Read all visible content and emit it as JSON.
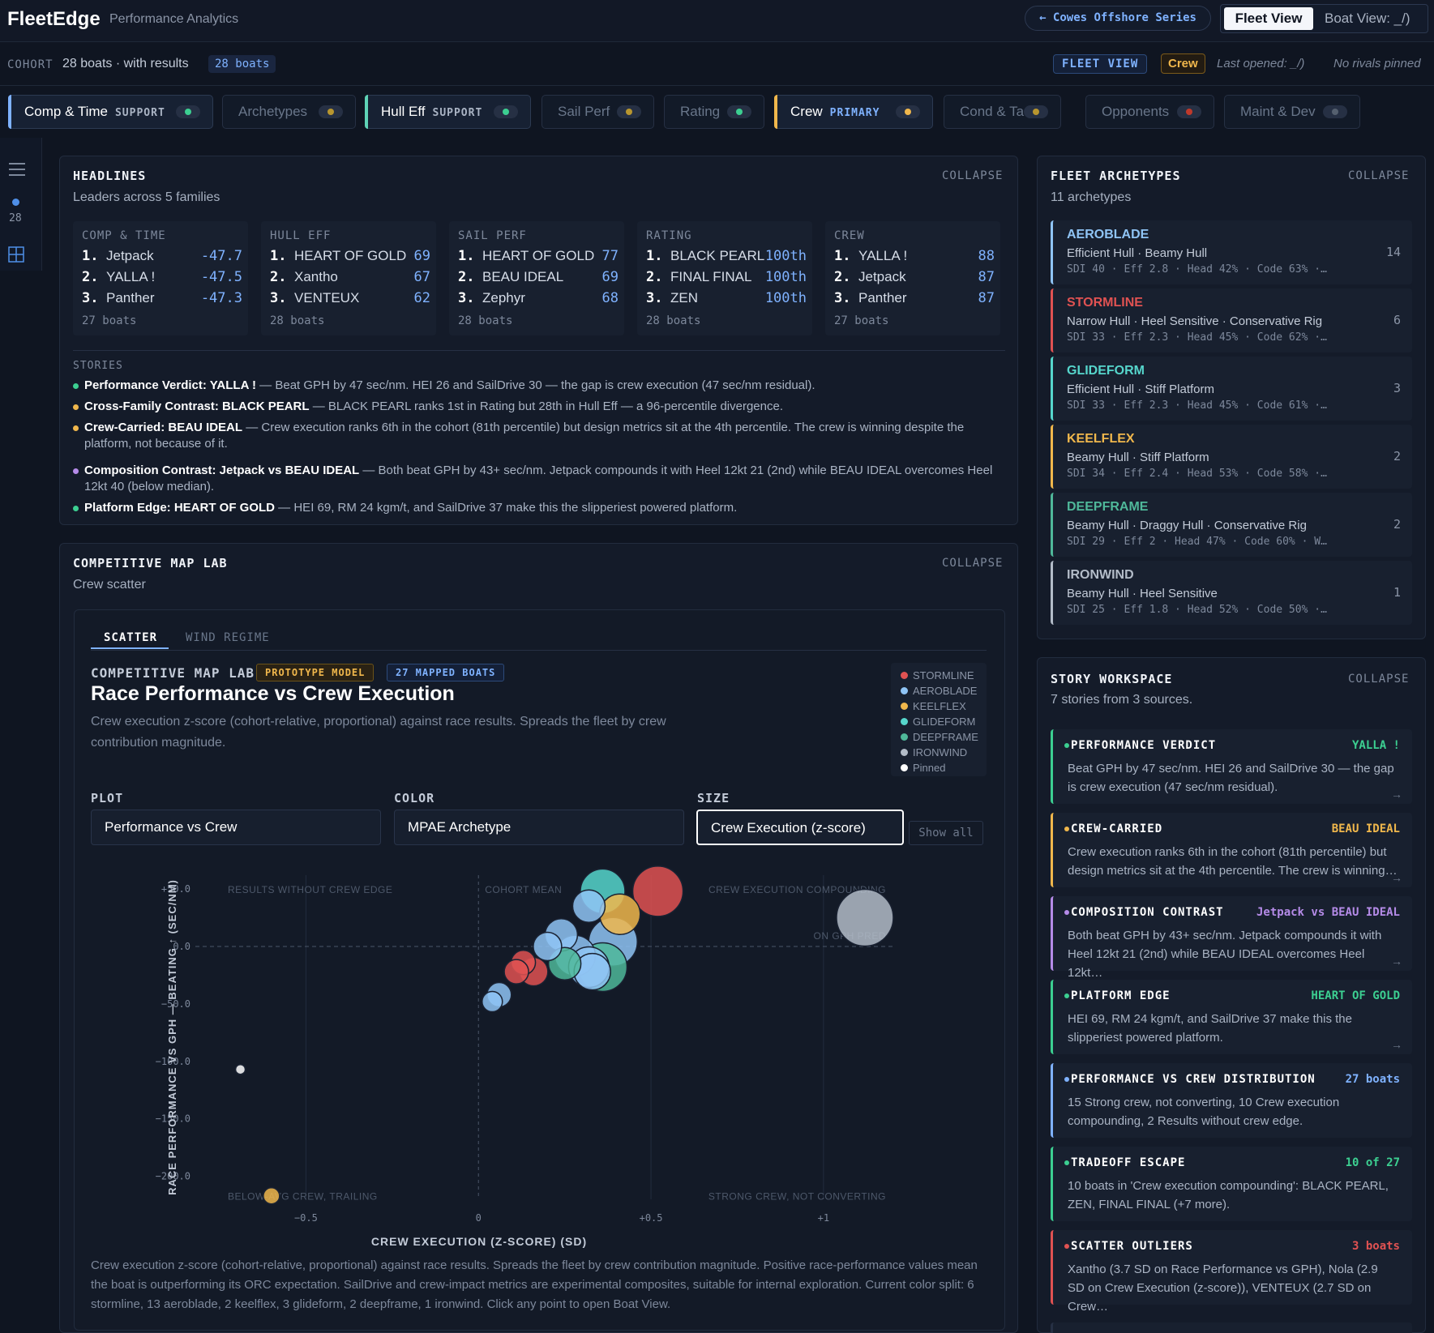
{
  "header": {
    "logo": "FleetEdge",
    "subtitle": "Performance Analytics",
    "series_button": "← Cowes Offshore Series",
    "fleet_view": "Fleet View",
    "boat_view": "Boat View: _/)"
  },
  "cohort": {
    "label": "COHORT",
    "text": "28 boats · with results",
    "badge": "28 boats",
    "fleet_view_badge": "FLEET VIEW",
    "crew_badge": "Crew",
    "last_opened": "Last opened: _/)",
    "no_rivals": "No rivals pinned"
  },
  "tabs": [
    {
      "label": "Comp & Time",
      "role": "SUPPORT",
      "active": true,
      "accent": "#7fb2ff",
      "dot": "#3ccf91"
    },
    {
      "label": "Archetypes",
      "role": "",
      "active": false,
      "dot": "#b8962f"
    },
    {
      "label": "Hull Eff",
      "role": "SUPPORT",
      "active": true,
      "accent": "#5fd3b6",
      "dot": "#3ccf91"
    },
    {
      "label": "Sail Perf",
      "role": "",
      "active": false,
      "dot": "#b8962f"
    },
    {
      "label": "Rating",
      "role": "",
      "active": false,
      "dot": "#3ccf91"
    },
    {
      "label": "Crew",
      "role": "PRIMARY",
      "active": true,
      "accent": "#f0b74c",
      "dot": "#f0b74c"
    },
    {
      "label": "Cond & Tac",
      "role": "",
      "active": false,
      "dot": "#b8962f"
    },
    {
      "label": "Opponents",
      "role": "",
      "active": false,
      "dot": "#c0392b"
    },
    {
      "label": "Maint & Dev",
      "role": "",
      "active": false,
      "dot": "#55606f"
    }
  ],
  "rail": {
    "count": "28"
  },
  "headlines": {
    "title": "HEADLINES",
    "subtitle": "Leaders across 5 families",
    "collapse": "COLLAPSE",
    "columns": [
      {
        "cat": "COMP & TIME",
        "rows": [
          [
            "1.",
            "Jetpack",
            "-47.7"
          ],
          [
            "2.",
            "YALLA !",
            "-47.5"
          ],
          [
            "3.",
            "Panther",
            "-47.3"
          ]
        ],
        "count": "27 boats"
      },
      {
        "cat": "HULL EFF",
        "rows": [
          [
            "1.",
            "HEART OF GOLD",
            "69"
          ],
          [
            "2.",
            "Xantho",
            "67"
          ],
          [
            "3.",
            "VENTEUX",
            "62"
          ]
        ],
        "count": "28 boats"
      },
      {
        "cat": "SAIL PERF",
        "rows": [
          [
            "1.",
            "HEART OF GOLD",
            "77"
          ],
          [
            "2.",
            "BEAU IDEAL",
            "69"
          ],
          [
            "3.",
            "Zephyr",
            "68"
          ]
        ],
        "count": "28 boats"
      },
      {
        "cat": "RATING",
        "rows": [
          [
            "1.",
            "BLACK PEARL",
            "100th"
          ],
          [
            "2.",
            "FINAL FINAL",
            "100th"
          ],
          [
            "3.",
            "ZEN",
            "100th"
          ]
        ],
        "count": "28 boats"
      },
      {
        "cat": "CREW",
        "rows": [
          [
            "1.",
            "YALLA !",
            "88"
          ],
          [
            "2.",
            "Jetpack",
            "87"
          ],
          [
            "3.",
            "Panther",
            "87"
          ]
        ],
        "count": "27 boats"
      }
    ],
    "stories_label": "STORIES",
    "stories": [
      {
        "color": "#3ccf91",
        "head": "Performance Verdict: YALLA !",
        "text": " — Beat GPH by 47 sec/nm. HEI 26 and SailDrive 30 — the gap is crew execution (47 sec/nm residual)."
      },
      {
        "color": "#f0b74c",
        "head": "Cross-Family Contrast: BLACK PEARL",
        "text": " — BLACK PEARL ranks 1st in Rating but 28th in Hull Eff — a 96-percentile divergence."
      },
      {
        "color": "#f0b74c",
        "head": "Crew-Carried: BEAU IDEAL",
        "text": " — Crew execution ranks 6th in the cohort (81th percentile) but design metrics sit at the 4th percentile. The crew is winning despite the platform, not because of it."
      },
      {
        "color": "#b58be8",
        "head": "Composition Contrast: Jetpack vs BEAU IDEAL",
        "text": " — Both beat GPH by 43+ sec/nm. Jetpack compounds it with Heel 12kt 21 (2nd) while BEAU IDEAL overcomes Heel 12kt 40 (below median)."
      },
      {
        "color": "#3ccf91",
        "head": "Platform Edge: HEART OF GOLD",
        "text": " — HEI 69, RM 24 kgm/t, and SailDrive 37 make this the slipperiest powered platform."
      }
    ]
  },
  "archetypes": {
    "title": "FLEET ARCHETYPES",
    "subtitle": "11 archetypes",
    "collapse": "COLLAPSE",
    "items": [
      {
        "name": "AEROBLADE",
        "color": "#8fc4f5",
        "desc": "Efficient Hull · Beamy Hull",
        "meta": "SDI 40 · Eff 2.8 · Head 42% · Code 63% ·…",
        "count": "14"
      },
      {
        "name": "STORMLINE",
        "color": "#e05252",
        "desc": "Narrow Hull · Heel Sensitive · Conservative Rig",
        "meta": "SDI 33 · Eff 2.3 · Head 45% · Code 62% ·…",
        "count": "6"
      },
      {
        "name": "GLIDEFORM",
        "color": "#56d6cc",
        "desc": "Efficient Hull · Stiff Platform",
        "meta": "SDI 33 · Eff 2.3 · Head 45% · Code 61% ·…",
        "count": "3"
      },
      {
        "name": "KEELFLEX",
        "color": "#f0b74c",
        "desc": "Beamy Hull · Stiff Platform",
        "meta": "SDI 34 · Eff 2.4 · Head 53% · Code 58% ·…",
        "count": "2"
      },
      {
        "name": "DEEPFRAME",
        "color": "#4fb89a",
        "desc": "Beamy Hull · Draggy Hull · Conservative Rig",
        "meta": "SDI 29 · Eff 2 · Head 47% · Code 60% · W…",
        "count": "2"
      },
      {
        "name": "IRONWIND",
        "color": "#b3bcc8",
        "desc": "Beamy Hull · Heel Sensitive",
        "meta": "SDI 25 · Eff 1.8 · Head 52% · Code 50% ·…",
        "count": "1"
      }
    ]
  },
  "workspace": {
    "title": "STORY WORKSPACE",
    "subtitle": "7 stories from 3 sources.",
    "collapse": "COLLAPSE",
    "cards": [
      {
        "title": "PERFORMANCE VERDICT",
        "right": "YALLA !",
        "rc": "#3ccf91",
        "bc": "#3ccf91",
        "text": "Beat GPH by 47 sec/nm. HEI 26 and SailDrive 30 — the gap is crew execution (47 sec/nm residual).",
        "arrow": "→"
      },
      {
        "title": "CREW-CARRIED",
        "right": "BEAU IDEAL",
        "rc": "#f0b74c",
        "bc": "#f0b74c",
        "text": "Crew execution ranks 6th in the cohort (81th percentile) but design metrics sit at the 4th percentile. The crew is winning…",
        "arrow": "→"
      },
      {
        "title": "COMPOSITION CONTRAST",
        "right": "Jetpack vs BEAU IDEAL",
        "rc": "#b58be8",
        "bc": "#b58be8",
        "text": "Both beat GPH by 43+ sec/nm. Jetpack compounds it with Heel 12kt 21 (2nd) while BEAU IDEAL overcomes Heel 12kt…",
        "arrow": "→"
      },
      {
        "title": "PLATFORM EDGE",
        "right": "HEART OF GOLD",
        "rc": "#3ccf91",
        "bc": "#3ccf91",
        "text": "HEI 69, RM 24 kgm/t, and SailDrive 37 make this the slipperiest powered platform.",
        "arrow": "→"
      },
      {
        "title": "PERFORMANCE VS CREW DISTRIBUTION",
        "right": "27 boats",
        "rc": "#7fb2ff",
        "bc": "#7fb2ff",
        "text": "15 Strong crew, not converting, 10 Crew execution compounding, 2 Results without crew edge.",
        "arrow": ""
      },
      {
        "title": "TRADEOFF ESCAPE",
        "right": "10 of 27",
        "rc": "#3ccf91",
        "bc": "#3ccf91",
        "text": "10 boats in 'Crew execution compounding': BLACK PEARL, ZEN, FINAL FINAL (+7 more).",
        "arrow": ""
      },
      {
        "title": "SCATTER OUTLIERS",
        "right": "3 boats",
        "rc": "#e05252",
        "bc": "#e05252",
        "text": "Xantho (3.7 SD on Race Performance vs GPH), Nola (2.9 SD on Crew Execution (z-score)), VENTEUX (2.7 SD on Crew…",
        "arrow": ""
      }
    ]
  },
  "maplab": {
    "title": "COMPETITIVE MAP LAB",
    "subtitle": "Crew scatter",
    "collapse": "COLLAPSE",
    "tab_scatter": "SCATTER",
    "tab_wind": "WIND REGIME",
    "eyebrow": "COMPETITIVE MAP LAB",
    "badge_model": "PROTOTYPE MODEL",
    "badge_boats": "27 MAPPED BOATS",
    "heading": "Race Performance vs Crew Execution",
    "description": "Crew execution z-score (cohort-relative, proportional) against race results. Spreads the fleet by crew contribution magnitude.",
    "plot_label": "PLOT",
    "plot_value": "Performance vs Crew",
    "color_label": "COLOR",
    "color_value": "MPAE Archetype",
    "size_label": "SIZE",
    "size_value": "Crew Execution (z-score)",
    "show_all": "Show all",
    "legend": [
      {
        "name": "STORMLINE",
        "color": "#e05252"
      },
      {
        "name": "AEROBLADE",
        "color": "#8fc4f5"
      },
      {
        "name": "KEELFLEX",
        "color": "#f0b74c"
      },
      {
        "name": "GLIDEFORM",
        "color": "#56d6cc"
      },
      {
        "name": "DEEPFRAME",
        "color": "#4fb89a"
      },
      {
        "name": "IRONWIND",
        "color": "#b3bcc8"
      },
      {
        "name": "Pinned",
        "color": "#ffffff"
      }
    ],
    "footer": "Crew execution z-score (cohort-relative, proportional) against race results. Spreads the fleet by crew contribution magnitude. Positive race-performance values mean the boat is outperforming its ORC expectation. SailDrive and crew-impact metrics are experimental composites, suitable for internal exploration. Current color split: 6 stormline, 13 aeroblade, 2 keelflex, 3 glideform, 2 deepframe, 1 ironwind. Click any point to open Boat View."
  },
  "chart_data": {
    "type": "scatter",
    "xlabel": "CREW EXECUTION (Z-SCORE) (SD)",
    "ylabel": "RACE PERFORMANCE VS GPH — BEATING ↑ (SEC/NM)",
    "xlim": [
      -0.75,
      1.2
    ],
    "ylim": [
      -220,
      62
    ],
    "x_ticks": [
      {
        "v": -0.5,
        "label": "−0.5"
      },
      {
        "v": 0,
        "label": "0"
      },
      {
        "v": 0.5,
        "label": "+0.5"
      },
      {
        "v": 1,
        "label": "+1"
      }
    ],
    "y_ticks": [
      {
        "v": 50,
        "label": "+50.0"
      },
      {
        "v": 0,
        "label": "0.0"
      },
      {
        "v": -50,
        "label": "−50.0"
      },
      {
        "v": -100,
        "label": "−100.0"
      },
      {
        "v": -150,
        "label": "−150.0"
      },
      {
        "v": -200,
        "label": "−200.0"
      }
    ],
    "quadrants": {
      "top_left": "RESULTS WITHOUT CREW EDGE",
      "top_center": "COHORT MEAN",
      "top_right": "CREW EXECUTION COMPOUNDING",
      "right_mid": "ON GPH PRED",
      "bottom_left": "BELOW-AVG CREW, TRAILING",
      "bottom_right": "STRONG CREW, NOT CONVERTING"
    },
    "points": [
      {
        "x": 0.52,
        "y": 48,
        "s": 0.52,
        "c": "#e05252"
      },
      {
        "x": 0.41,
        "y": 28,
        "s": 0.4,
        "c": "#f0b74c"
      },
      {
        "x": 0.32,
        "y": 35,
        "s": 0.3,
        "c": "#8fc4f5"
      },
      {
        "x": 0.36,
        "y": 48,
        "s": 0.45,
        "c": "#56d6cc"
      },
      {
        "x": 0.24,
        "y": 10,
        "s": 0.3,
        "c": "#8fc4f5"
      },
      {
        "x": 0.39,
        "y": 4,
        "s": 0.5,
        "c": "#8fc4f5"
      },
      {
        "x": 0.2,
        "y": 0,
        "s": 0.25,
        "c": "#8fc4f5"
      },
      {
        "x": 0.28,
        "y": -8,
        "s": 0.4,
        "c": "#8fc4f5"
      },
      {
        "x": 0.32,
        "y": -18,
        "s": 0.4,
        "c": "#8fc4f5"
      },
      {
        "x": 0.33,
        "y": -22,
        "s": 0.35,
        "c": "#8fc4f5"
      },
      {
        "x": 0.25,
        "y": -15,
        "s": 0.3,
        "c": "#4fb89a"
      },
      {
        "x": 0.36,
        "y": -18,
        "s": 0.5,
        "c": "#4fb89a"
      },
      {
        "x": 0.13,
        "y": -14,
        "s": 0.2,
        "c": "#e05252"
      },
      {
        "x": 0.11,
        "y": -22,
        "s": 0.2,
        "c": "#e05252"
      },
      {
        "x": 0.16,
        "y": -22,
        "s": 0.25,
        "c": "#e05252"
      },
      {
        "x": 0.06,
        "y": -42,
        "s": 0.2,
        "c": "#8fc4f5"
      },
      {
        "x": 0.04,
        "y": -48,
        "s": 0.15,
        "c": "#8fc4f5"
      },
      {
        "x": 1.12,
        "y": 25,
        "s": 0.6,
        "c": "#b3bcc8"
      },
      {
        "x": -0.69,
        "y": -107,
        "s": 0.02,
        "c": "#ffffff"
      },
      {
        "x": -0.6,
        "y": -217,
        "s": 0.1,
        "c": "#f0b74c"
      }
    ]
  }
}
